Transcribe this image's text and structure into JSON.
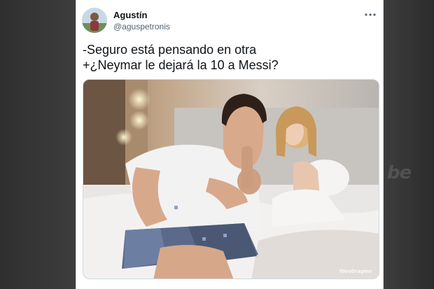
{
  "tweet": {
    "author": {
      "display_name": "Agustín",
      "handle": "@aguspetronis"
    },
    "text_lines": [
      "-Seguro está pensando en otra",
      "+¿Neymar le dejará la 10 a Messi?"
    ],
    "more_icon": "more-horizontal-icon",
    "media": {
      "credit": "filesGrapter"
    }
  },
  "background": {
    "watermark": "be"
  },
  "colors": {
    "card_bg": "#ffffff",
    "text": "#0f1419",
    "secondary_text": "#536471",
    "page_bg": "#3a3a3a"
  }
}
